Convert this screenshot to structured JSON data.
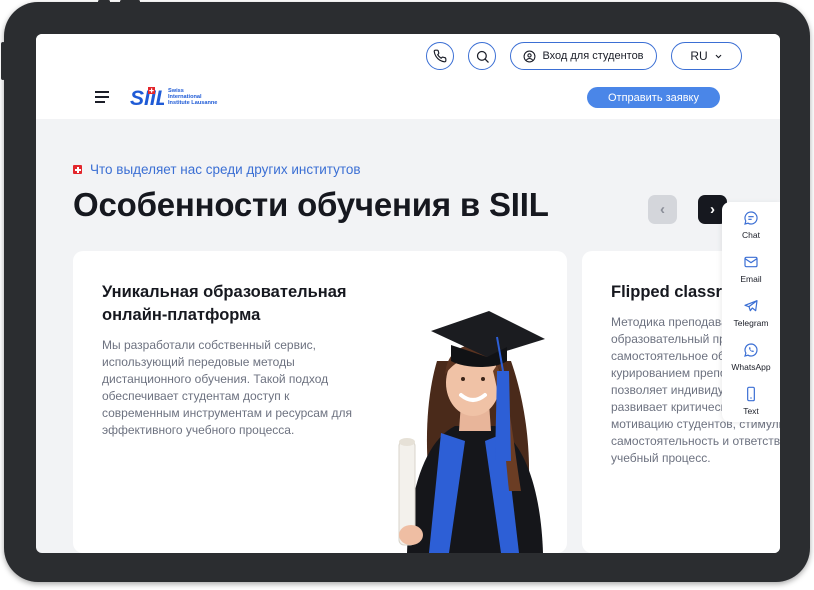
{
  "header": {
    "students_login_label": "Вход для студентов",
    "language": "RU",
    "apply_label": "Отправить заявку",
    "logo": {
      "line1": "Swiss",
      "line2": "International",
      "line3": "Institute Lausanne"
    }
  },
  "section": {
    "eyebrow": "Что выделяет нас среди других институтов",
    "title": "Особенности обучения в SIIL",
    "prev_icon": "‹",
    "next_icon": "›"
  },
  "cards": [
    {
      "title_line1": "Уникальная образовательная",
      "title_line2": "онлайн-платформа",
      "text": [
        "Мы разработали собственный сервис,",
        "использующий передовые методы",
        "дистанционного обучения. Такой подход",
        "обеспечивает студентам доступ к",
        "современным инструментам и ресурсам для",
        "эффективного учебного процесса."
      ]
    },
    {
      "title_line1": "Flipped classroom",
      "text": [
        "Методика преподавания",
        "образовательный процесс",
        "самостоятельное обучение",
        "курированием преподавателя",
        "позволяет индивидуально",
        "развивает критическое",
        "мотивацию студентов, стимулирует",
        "самостоятельность и ответственность",
        "учебный процесс."
      ]
    }
  ],
  "contact_bar": [
    {
      "label": "Chat",
      "icon": "chat-icon"
    },
    {
      "label": "Email",
      "icon": "email-icon"
    },
    {
      "label": "Telegram",
      "icon": "telegram-icon"
    },
    {
      "label": "WhatsApp",
      "icon": "whatsapp-icon"
    },
    {
      "label": "Text",
      "icon": "phone-text-icon"
    }
  ],
  "colors": {
    "accent": "#3b6fd4",
    "button_blue": "#4a86e8",
    "swiss_red": "#e3262c",
    "dark": "#16181f"
  }
}
